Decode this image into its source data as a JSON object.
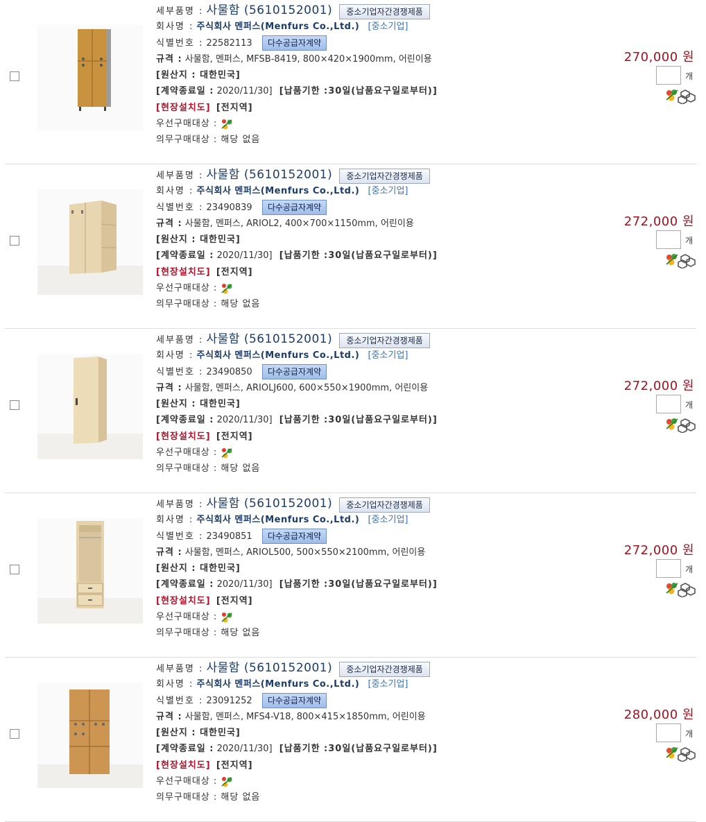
{
  "labels": {
    "product_name": "세부품명 :",
    "company": "회사명 :",
    "id": "식별번호 :",
    "spec": "규격 :",
    "origin": "[원산지 : 대한민국]",
    "contract_end": "[계약종료일 :",
    "delivery": "[납품기한 :30일(납품요구일로부터)]",
    "install": "[현장설치도]",
    "region": "[전지역]",
    "priority": "우선구매대상 :",
    "mandatory": "의무구매대상 : 해당 없음",
    "unit": "개"
  },
  "badges": {
    "competition": "중소기업자간경쟁제품",
    "multi_supplier": "다수공급자계약"
  },
  "items": [
    {
      "name": "사물함 (5610152001)",
      "company": "주식회사 멘퍼스(Menfurs Co.,Ltd.)",
      "sme": "[중소기업]",
      "id": "22582113",
      "spec": "사물함, 멘퍼스, MFSB-8419, 800×420×1900mm, 어린이용",
      "contract_date": "2020/11/30]",
      "price": "270,000 원",
      "qty": "",
      "thumb": "locker-wood-4door"
    },
    {
      "name": "사물함 (5610152001)",
      "company": "주식회사 멘퍼스(Menfurs Co.,Ltd.)",
      "sme": "[중소기업]",
      "id": "23490839",
      "spec": "사물함, 멘퍼스, ARIOL2, 400×700×1150mm, 어린이용",
      "contract_date": "2020/11/30]",
      "price": "272,000 원",
      "qty": "",
      "thumb": "locker-maple-shelf"
    },
    {
      "name": "사물함 (5610152001)",
      "company": "주식회사 멘퍼스(Menfurs Co.,Ltd.)",
      "sme": "[중소기업]",
      "id": "23490850",
      "spec": "사물함, 멘퍼스, ARIOLJ600, 600×550×1900mm, 어린이용",
      "contract_date": "2020/11/30]",
      "price": "272,000 원",
      "qty": "",
      "thumb": "locker-maple-tall"
    },
    {
      "name": "사물함 (5610152001)",
      "company": "주식회사 멘퍼스(Menfurs Co.,Ltd.)",
      "sme": "[중소기업]",
      "id": "23490851",
      "spec": "사물함, 멘퍼스, ARIOL500, 500×550×2100mm, 어린이용",
      "contract_date": "2020/11/30]",
      "price": "272,000 원",
      "qty": "",
      "thumb": "locker-open-drawers"
    },
    {
      "name": "사물함 (5610152001)",
      "company": "주식회사 멘퍼스(Menfurs Co.,Ltd.)",
      "sme": "[중소기업]",
      "id": "23091252",
      "spec": "사물함, 멘퍼스, MFS4-V18, 800×415×1850mm, 어린이용",
      "contract_date": "2020/11/30]",
      "price": "280,000 원",
      "qty": "",
      "thumb": "locker-wood-6door"
    }
  ],
  "colors": {
    "price": "#a3111f",
    "company": "#1c3c6a",
    "sme": "#3a73b8",
    "install": "#b3122a"
  },
  "icons": {
    "priority": "green-mark-icon",
    "cart": "cart-icon",
    "compare": "compare-icon"
  }
}
